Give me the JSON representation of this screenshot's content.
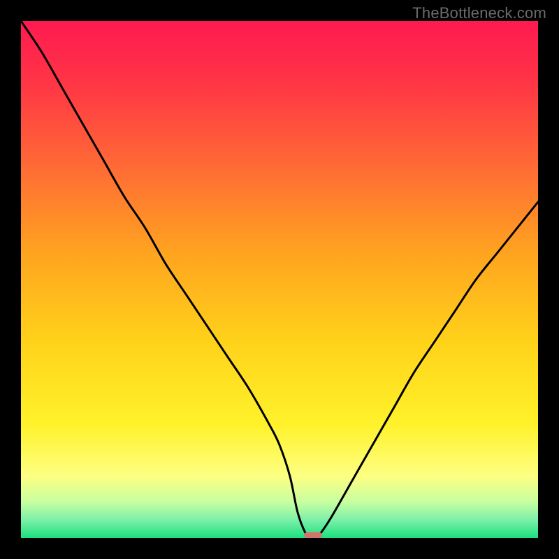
{
  "watermark": {
    "text": "TheBottleneck.com"
  },
  "chart_data": {
    "type": "line",
    "title": "",
    "xlabel": "",
    "ylabel": "",
    "xlim": [
      0,
      100
    ],
    "ylim": [
      0,
      100
    ],
    "grid": false,
    "legend": false,
    "background_gradient": {
      "stops": [
        {
          "offset": 0.0,
          "color": "#ff1a51"
        },
        {
          "offset": 0.12,
          "color": "#ff3545"
        },
        {
          "offset": 0.28,
          "color": "#ff6a35"
        },
        {
          "offset": 0.45,
          "color": "#ffa41f"
        },
        {
          "offset": 0.62,
          "color": "#ffd21a"
        },
        {
          "offset": 0.78,
          "color": "#fff22a"
        },
        {
          "offset": 0.88,
          "color": "#fdff82"
        },
        {
          "offset": 0.93,
          "color": "#c8ffa0"
        },
        {
          "offset": 0.965,
          "color": "#7cf0a8"
        },
        {
          "offset": 1.0,
          "color": "#1be07e"
        }
      ]
    },
    "series": [
      {
        "name": "bottleneck-curve",
        "x": [
          0,
          4,
          8,
          12,
          16,
          20,
          24,
          28,
          32,
          36,
          40,
          44,
          48,
          50,
          52,
          53.5,
          55,
          56,
          57,
          58,
          60,
          64,
          68,
          72,
          76,
          80,
          84,
          88,
          92,
          96,
          100
        ],
        "y": [
          100,
          94,
          87,
          80,
          73,
          66,
          60,
          53,
          47,
          41,
          35,
          29,
          22,
          18,
          12,
          5,
          1,
          0,
          0,
          1,
          4,
          11,
          18,
          25,
          32,
          38,
          44,
          50,
          55,
          60,
          65
        ]
      }
    ],
    "marker": {
      "name": "optimal-point",
      "x": 56.5,
      "y": 0,
      "width": 3.5,
      "height": 1.2,
      "color": "#d2746d"
    },
    "curve_color": "#000000",
    "curve_width": 3
  }
}
